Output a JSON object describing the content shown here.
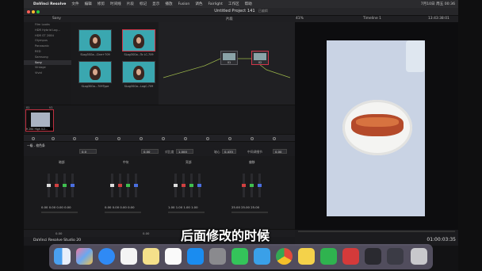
{
  "menubar": {
    "app_name": "DaVinci Resolve",
    "items": [
      "文件",
      "编辑",
      "修剪",
      "时间线",
      "片段",
      "标记",
      "显示",
      "播放",
      "Fusion",
      "调色",
      "Fairlight",
      "工作区",
      "帮助"
    ],
    "clock": "7月10日 周五 00:36"
  },
  "window": {
    "title": "Untitled Project 141",
    "title_status": "已编辑"
  },
  "toolbar": {
    "album": "Sony",
    "node_mode": "片段",
    "zoom": "41%",
    "timeline": "Timeline 1",
    "timecode": "13:43:38:01"
  },
  "gallery_list": [
    "Film Looks",
    "HDR Hybrid Log...",
    "HDR ST 2084",
    "Olympus",
    "Panasonic",
    "RED",
    "Samsung",
    "Sony",
    "Vintage",
    "Vivid"
  ],
  "gallery_selected": "Sony",
  "stills": [
    {
      "caption": "SLog3SGa...Cine+709"
    },
    {
      "caption": "SLog3SGa...To LC-709"
    },
    {
      "caption": "SLog3SGa...709Type"
    },
    {
      "caption": "SLog3SGa...LogC-709"
    }
  ],
  "nodes": [
    {
      "label": "01"
    },
    {
      "label": "02"
    }
  ],
  "clip": {
    "number": "01",
    "track": "V1",
    "name": "H.264 High 4:2..."
  },
  "primaries": {
    "section": "一级 - 校色条",
    "params": [
      {
        "label": "对比度",
        "value": "1.000"
      },
      {
        "label": "轴心",
        "value": "0.435"
      },
      {
        "label": "中间调细节",
        "value": "0.00"
      }
    ],
    "temp_value": "0.0",
    "tint_value": "0.00",
    "wheels": [
      {
        "label": "暗部",
        "values": [
          "0.00",
          "0.00",
          "0.00",
          "0.00"
        ]
      },
      {
        "label": "中灰",
        "values": [
          "0.00",
          "0.00",
          "0.00",
          "0.00"
        ]
      },
      {
        "label": "亮部",
        "values": [
          "1.00",
          "1.00",
          "1.00",
          "1.00"
        ]
      },
      {
        "label": "偏移",
        "values": [
          "25.00",
          "25.00",
          "25.00"
        ]
      }
    ]
  },
  "bottom": {
    "left_value": "0.00",
    "middle_value": "0.00",
    "brand": "DaVinci Resolve Studio 20"
  },
  "viewer": {
    "playhead_timecode": "01:00:03:35"
  },
  "subtitle": "后面修改的时候",
  "dock_icons": [
    "finder-icon",
    "launchpad-icon",
    "safari-icon",
    "reminders-icon",
    "notes-icon",
    "freeform-icon",
    "appstore-icon",
    "settings-icon",
    "wechat-icon",
    "qq-icon",
    "chrome-icon",
    "qq-browser-icon",
    "wechat-work-icon",
    "wps-icon",
    "davinci-icon",
    "capture-icon",
    "trash-icon"
  ],
  "colors": {
    "accent_red": "#c03040",
    "panel": "#1c1c1f"
  }
}
